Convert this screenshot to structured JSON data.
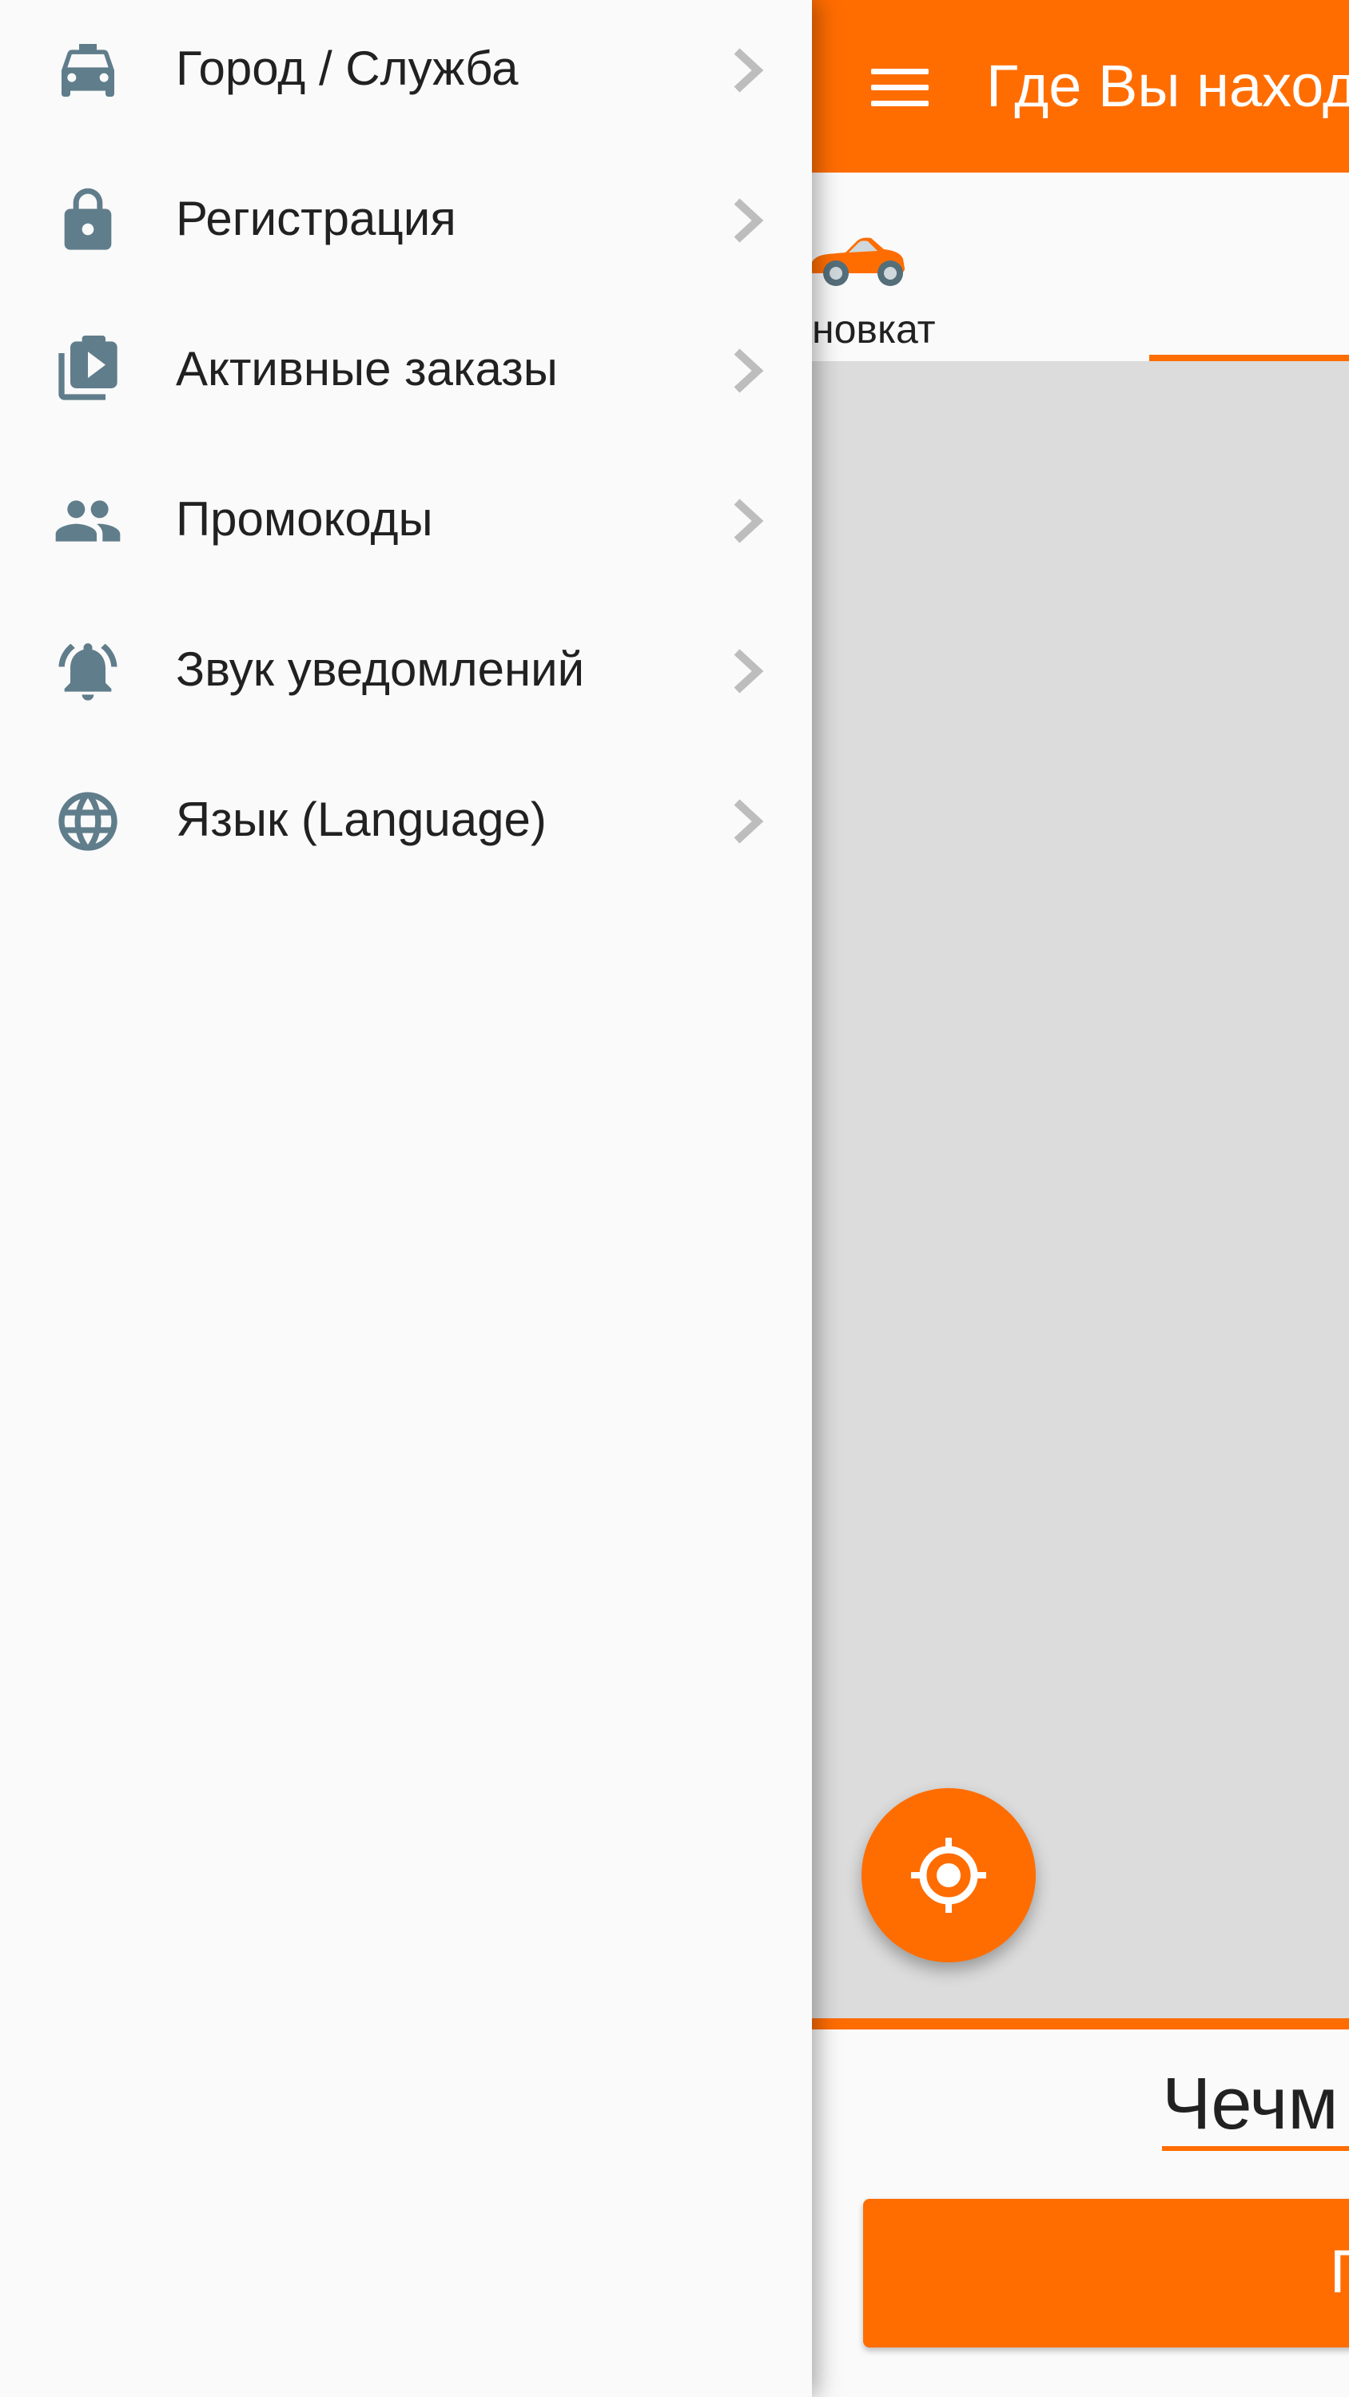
{
  "colors": {
    "accent": "#ff6d00",
    "drawer_icon": "#607d8b",
    "chevron": "#bdbdbd",
    "map": "#dcdcdc",
    "text": "#212121"
  },
  "drawer": {
    "items": [
      {
        "label": "Город / Служба",
        "icon": "taxi-icon"
      },
      {
        "label": "Регистрация",
        "icon": "lock-icon"
      },
      {
        "label": "Активные заказы",
        "icon": "video-collection-icon"
      },
      {
        "label": "Промокоды",
        "icon": "people-icon"
      },
      {
        "label": "Звук уведомлений",
        "icon": "bell-ringing-icon"
      },
      {
        "label": "Язык (Language)",
        "icon": "globe-icon"
      }
    ]
  },
  "main": {
    "appbar": {
      "title": "Где Вы наход"
    },
    "tabs": {
      "visible_label": "новкат"
    },
    "address": {
      "value": "Чечм"
    },
    "order_button": {
      "label": "П"
    }
  }
}
